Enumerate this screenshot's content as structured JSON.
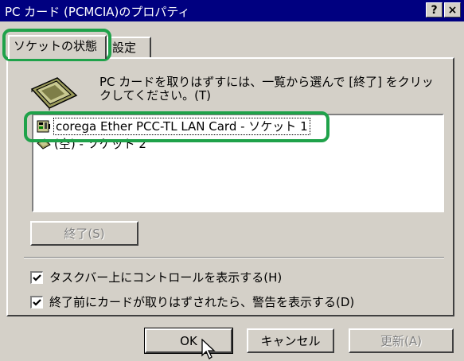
{
  "window": {
    "title": "PC カード (PCMCIA)のプロパティ",
    "help_button": "?",
    "close_button": "×"
  },
  "tabs": [
    {
      "label": "ソケットの状態"
    },
    {
      "label": "設定"
    }
  ],
  "instruction": "PC カードを取りはずすには、一覧から選んで [終了] をクリックしてください。(T)",
  "list": {
    "items": [
      {
        "label": "corega Ether PCC-TL LAN Card - ソケット 1"
      },
      {
        "label": "(空) - ソケット 2"
      }
    ]
  },
  "stop_button": "終了(S)",
  "checkboxes": [
    {
      "label": "タスクバー上にコントロールを表示する(H)"
    },
    {
      "label": "終了前にカードが取りはずされたら、警告を表示する(D)"
    }
  ],
  "buttons": {
    "ok": "OK",
    "cancel": "キャンセル",
    "refresh": "更新(A)"
  },
  "colors": {
    "title_bar": "#000080",
    "highlight": "#1fa24a",
    "face": "#d4d0c8"
  }
}
